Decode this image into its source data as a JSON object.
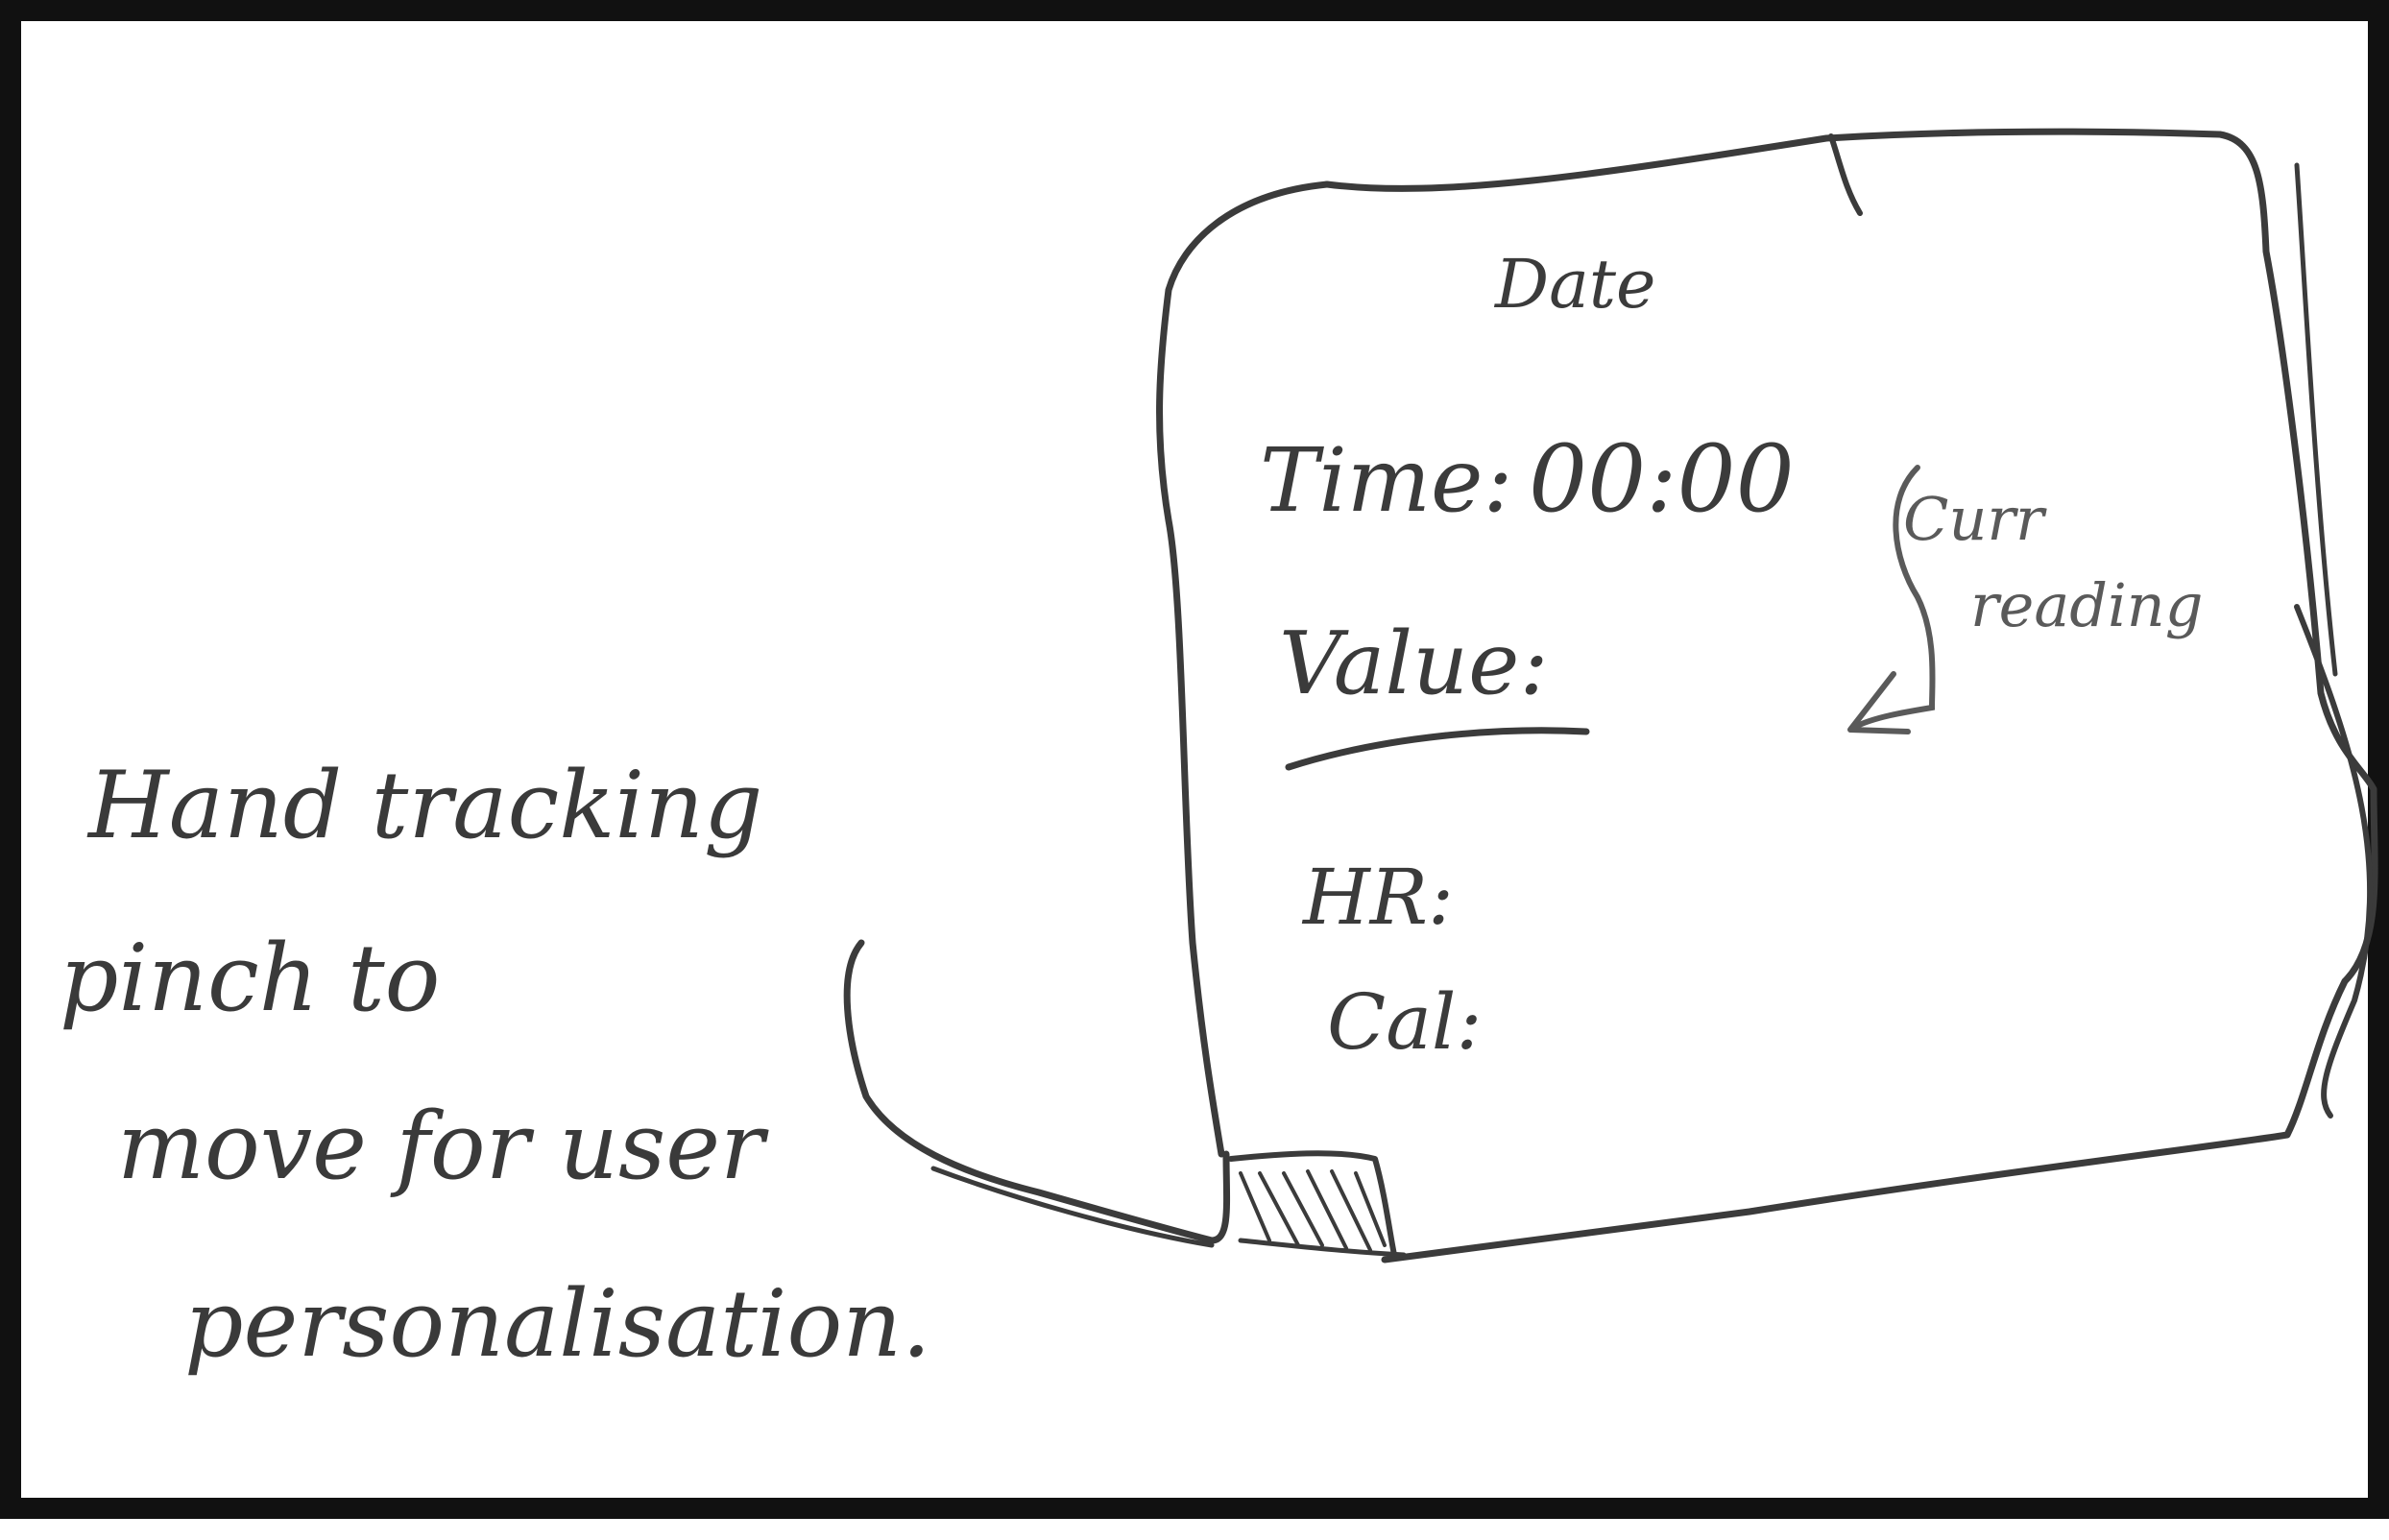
{
  "note_lines": [
    "Hand tracking",
    "pinch to",
    "move for user",
    "personalisation."
  ],
  "card": {
    "title": "Date",
    "time_label": "Time:",
    "time_value": "00:00",
    "value_label": "Value:",
    "hr_label": "HR:",
    "cal_label": "Cal:"
  },
  "side_annotation": {
    "line1": "Curr",
    "line2": "reading"
  },
  "colors": {
    "ink": "#3b3b3b",
    "ink_light": "#5a5a5a",
    "border": "#111111",
    "background": "#ffffff"
  }
}
